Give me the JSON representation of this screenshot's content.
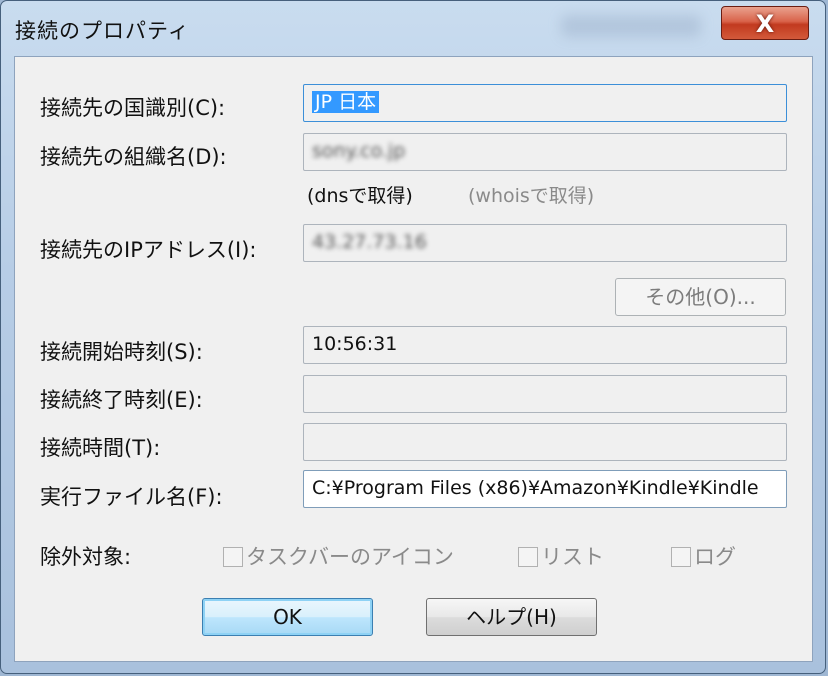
{
  "window": {
    "title": "接続のプロパティ",
    "close_glyph": "X"
  },
  "fields": {
    "country": {
      "label": "接続先の国識別(C):",
      "value": "JP 日本"
    },
    "org": {
      "label": "接続先の組織名(D):",
      "value": "sony.co.jp"
    },
    "dns_note": "(dnsで取得)",
    "whois_note": "(whoisで取得)",
    "ip": {
      "label": "接続先のIPアドレス(I):",
      "value": "43.27.73.16"
    },
    "start": {
      "label": "接続開始時刻(S):",
      "value": "10:56:31"
    },
    "end": {
      "label": "接続終了時刻(E):",
      "value": ""
    },
    "duration": {
      "label": "接続時間(T):",
      "value": ""
    },
    "exe": {
      "label": "実行ファイル名(F):",
      "value": "C:¥Program Files (x86)¥Amazon¥Kindle¥Kindle"
    }
  },
  "buttons": {
    "other": "その他(O)...",
    "ok": "OK",
    "help": "ヘルプ(H)"
  },
  "exclude": {
    "label": "除外対象:",
    "options": [
      {
        "label": "タスクバーのアイコン",
        "checked": false
      },
      {
        "label": "リスト",
        "checked": false
      },
      {
        "label": "ログ",
        "checked": false
      }
    ]
  }
}
